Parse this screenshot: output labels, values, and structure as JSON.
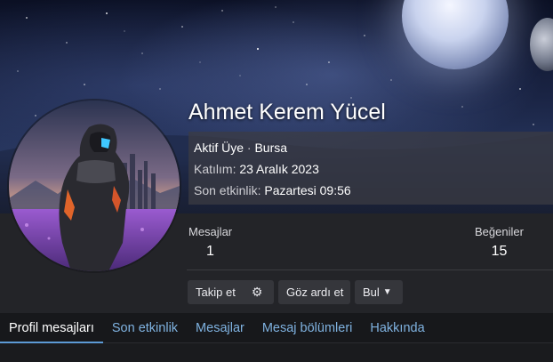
{
  "profile": {
    "name": "Ahmet Kerem Yücel",
    "role": "Aktif Üye",
    "separator": "·",
    "location": "Bursa",
    "joined_label": "Katılım:",
    "joined_value": "23 Aralık 2023",
    "last_activity_label": "Son etkinlik:",
    "last_activity_value": "Pazartesi 09:56"
  },
  "stats": {
    "messages_label": "Mesajlar",
    "messages_value": "1",
    "likes_label": "Beğeniler",
    "likes_value": "15"
  },
  "actions": {
    "follow_label": "Takip et",
    "settings_icon": "gear-icon",
    "ignore_label": "Göz ardı et",
    "find_label": "Bul",
    "find_icon": "caret-down-icon"
  },
  "tabs": [
    {
      "label": "Profil mesajları",
      "active": true
    },
    {
      "label": "Son etkinlik",
      "active": false
    },
    {
      "label": "Mesajlar",
      "active": false
    },
    {
      "label": "Mesaj bölümleri",
      "active": false
    },
    {
      "label": "Hakkında",
      "active": false
    }
  ],
  "colors": {
    "tab_link": "#7fb2e0",
    "tab_active_underline": "#5c9ad6",
    "panel_bg": "#232428",
    "button_bg": "#35363b"
  }
}
